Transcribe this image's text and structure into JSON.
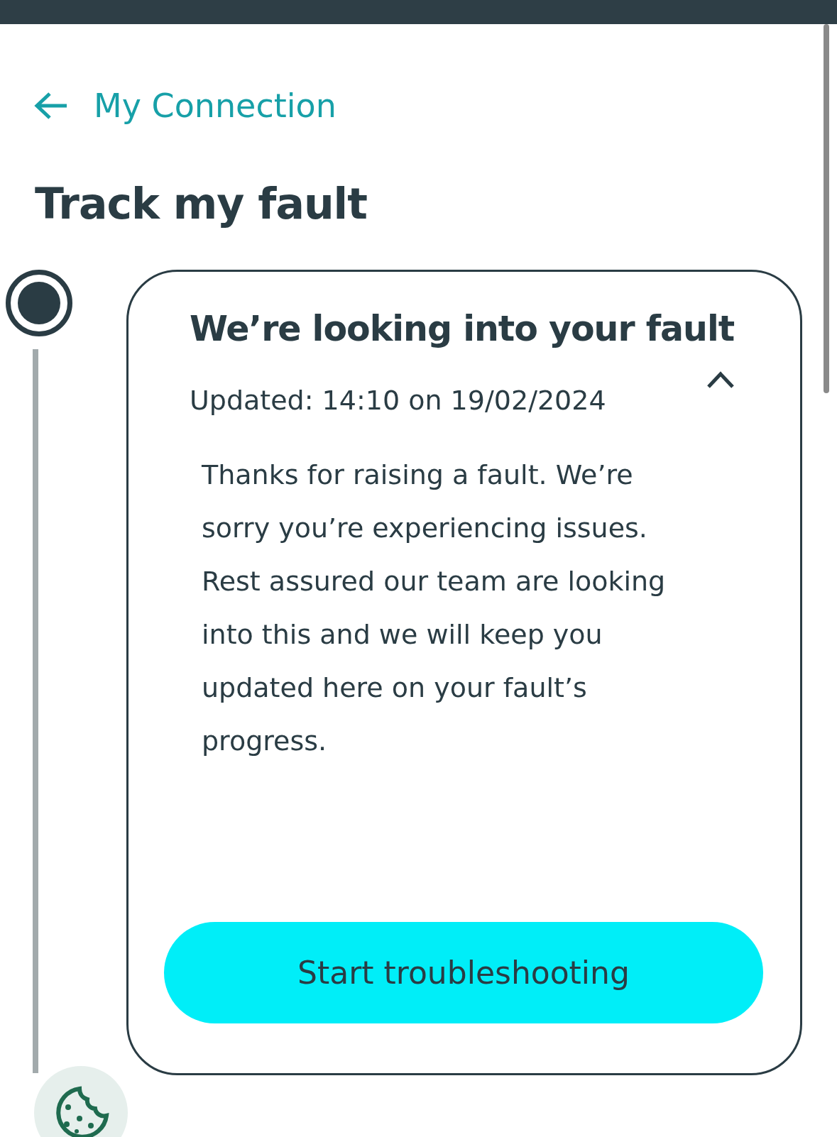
{
  "header": {
    "back_link": "My Connection"
  },
  "title": "Track my fault",
  "timeline": [
    {
      "kind": "current",
      "title": "We’re looking into your fault",
      "updated": "Updated: 14:10 on 19/02/2024",
      "expanded": true,
      "description": "Thanks for raising a fault. We’re sorry you’re experiencing issues. Rest assured our team are looking into this and we will keep you updated here on your fault’s progress.",
      "action": "Start troubleshooting"
    }
  ]
}
